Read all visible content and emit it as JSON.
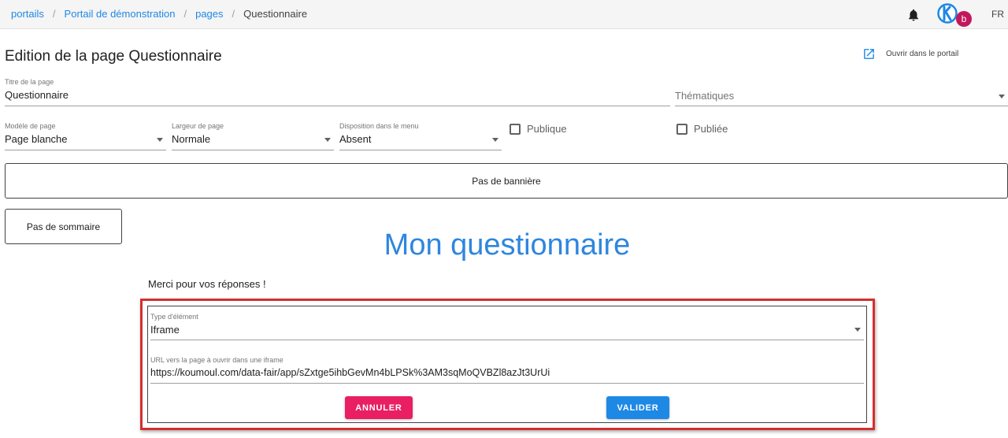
{
  "breadcrumb": {
    "items": [
      "portails",
      "Portail de démonstration",
      "pages"
    ],
    "current": "Questionnaire"
  },
  "topbar": {
    "avatar_letter": "b",
    "lang": "FR"
  },
  "header": {
    "title": "Edition de la page Questionnaire",
    "open_portal_label": "Ouvrir dans le portail"
  },
  "form": {
    "title_label": "Titre de la page",
    "title_value": "Questionnaire",
    "topics_placeholder": "Thématiques",
    "template_label": "Modèle de page",
    "template_value": "Page blanche",
    "width_label": "Largeur de page",
    "width_value": "Normale",
    "menu_label": "Disposition dans le menu",
    "menu_value": "Absent",
    "public_label": "Publique",
    "published_label": "Publiée"
  },
  "banner_label": "Pas de bannière",
  "toc_label": "Pas de sommaire",
  "content": {
    "heading": "Mon questionnaire",
    "thanks": "Merci pour vos réponses !"
  },
  "editor": {
    "type_label": "Type d'élément",
    "type_value": "Iframe",
    "url_label": "URL vers la page à ouvrir dans une iframe",
    "url_value": "https://koumoul.com/data-fair/app/sZxtge5ihbGevMn4bLPSk%3AM3sqMoQVBZl8azJt3UrUi",
    "cancel_label": "ANNULER",
    "ok_label": "VALIDER"
  },
  "colors": {
    "link": "#1e88e5",
    "heading": "#2e86de",
    "cancel": "#e91e63",
    "validate": "#1e88e5",
    "highlight": "#d32f2f"
  }
}
